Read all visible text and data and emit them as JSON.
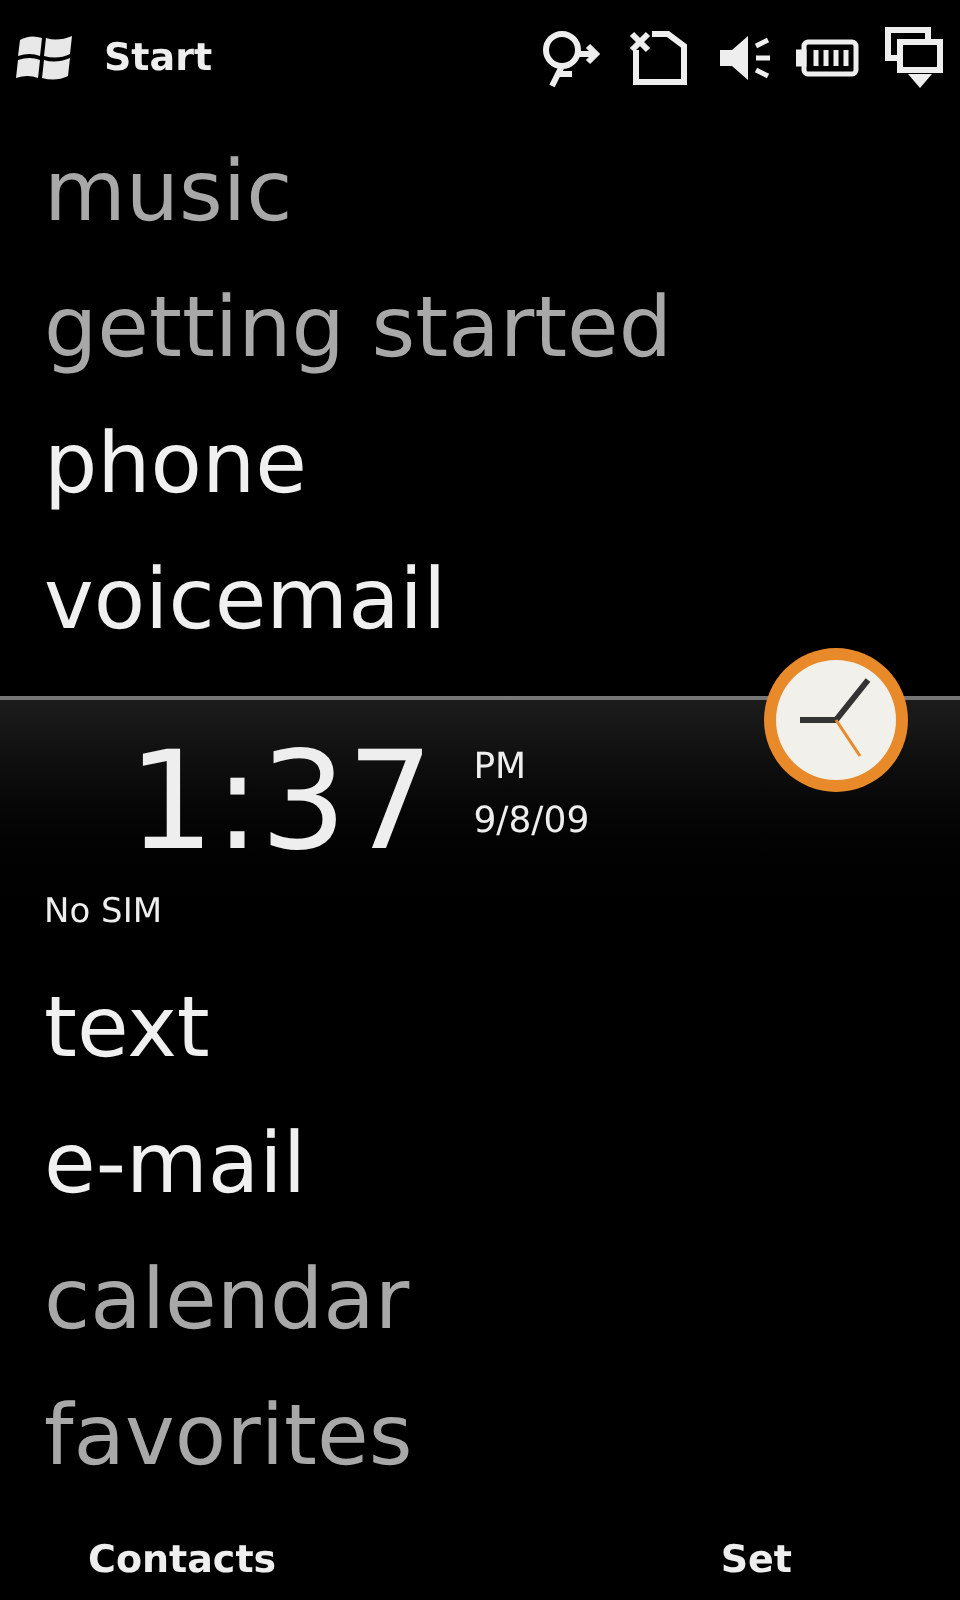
{
  "status_bar": {
    "start": "Start"
  },
  "menu_top": [
    {
      "label": "music",
      "faded": true
    },
    {
      "label": "getting started",
      "faded": true
    },
    {
      "label": "phone",
      "faded": false
    },
    {
      "label": "voicemail",
      "faded": false
    }
  ],
  "clock": {
    "time": "1:37",
    "ampm": "PM",
    "date": "9/8/09",
    "network": "No SIM"
  },
  "menu_bottom": [
    {
      "label": "text",
      "faded": false
    },
    {
      "label": "e-mail",
      "faded": false
    },
    {
      "label": "calendar",
      "faded": true
    },
    {
      "label": "favorites",
      "faded": true
    }
  ],
  "softkeys": {
    "left": "Contacts",
    "right": "Set"
  }
}
